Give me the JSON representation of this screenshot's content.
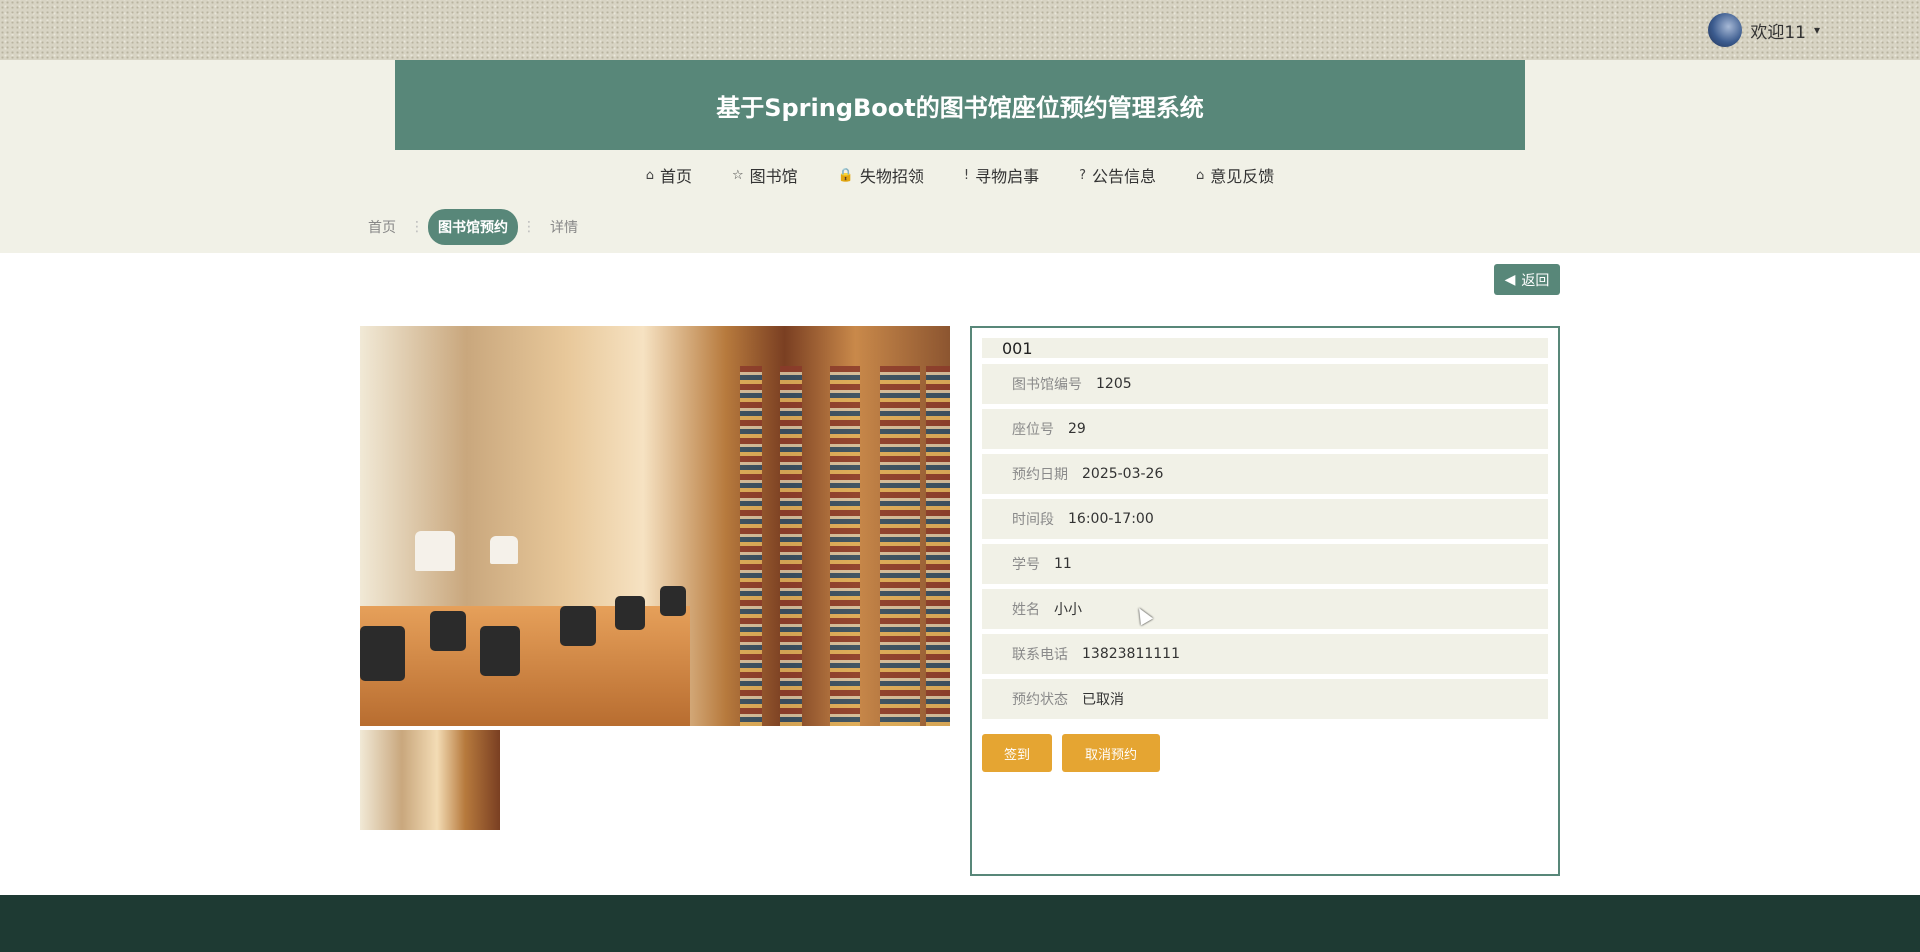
{
  "topbar": {
    "welcome_text": "欢迎11",
    "caret": "▾"
  },
  "header": {
    "title": "基于SpringBoot的图书馆座位预约管理系统"
  },
  "nav": {
    "items": [
      {
        "label": "首页",
        "icon": "⌂"
      },
      {
        "label": "图书馆",
        "icon": "☆"
      },
      {
        "label": "失物招领",
        "icon": "🔒"
      },
      {
        "label": "寻物启事",
        "icon": "!"
      },
      {
        "label": "公告信息",
        "icon": "?"
      },
      {
        "label": "意见反馈",
        "icon": "⌂"
      }
    ]
  },
  "breadcrumb": {
    "home": "首页",
    "current": "图书馆预约",
    "detail": "详情",
    "sep": "⋮"
  },
  "back_button": {
    "label": "返回",
    "icon": "◀"
  },
  "detail": {
    "title": "001",
    "fields": [
      {
        "label": "图书馆编号",
        "value": "1205"
      },
      {
        "label": "座位号",
        "value": "29"
      },
      {
        "label": "预约日期",
        "value": "2025-03-26"
      },
      {
        "label": "时间段",
        "value": "16:00-17:00"
      },
      {
        "label": "学号",
        "value": "11"
      },
      {
        "label": "姓名",
        "value": "小小"
      },
      {
        "label": "联系电话",
        "value": "13823811111"
      },
      {
        "label": "预约状态",
        "value": "已取消"
      }
    ]
  },
  "actions": {
    "sign_in": "签到",
    "cancel": "取消预约"
  },
  "colors": {
    "primary": "#588779",
    "accent": "#e5a532",
    "band": "#f1f1e7",
    "footer": "#1e3a33"
  }
}
